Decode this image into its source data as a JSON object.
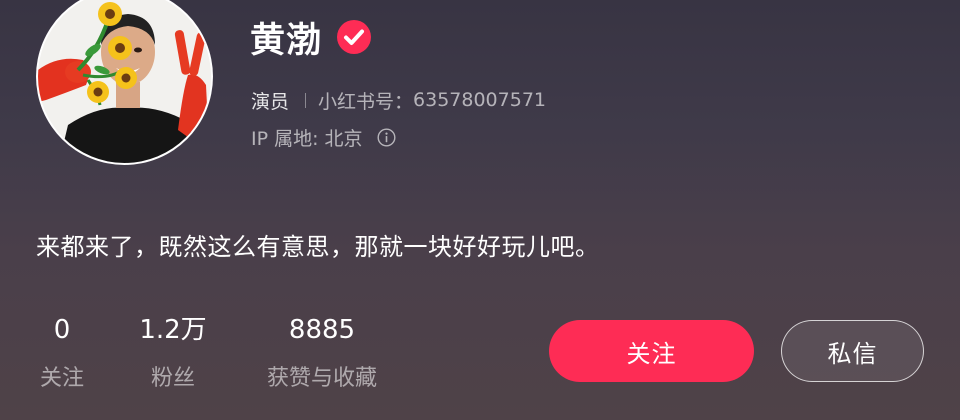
{
  "profile": {
    "name": "黄渤",
    "verified": true,
    "role": "演员",
    "id_label": "小红书号：",
    "id_value": "63578007571",
    "ip_location": "IP 属地: 北京",
    "bio": "来都来了，既然这么有意思，那就一块好好玩儿吧。"
  },
  "stats": [
    {
      "value": "0",
      "label": "关注"
    },
    {
      "value": "1.2万",
      "label": "粉丝"
    },
    {
      "value": "8885",
      "label": "获赞与收藏"
    }
  ],
  "actions": {
    "follow_label": "关注",
    "message_label": "私信"
  },
  "icons": {
    "verified": "verified-check-icon",
    "info": "info-circle-icon"
  },
  "colors": {
    "accent": "#fe2c55",
    "verified": "#fe2c55"
  }
}
